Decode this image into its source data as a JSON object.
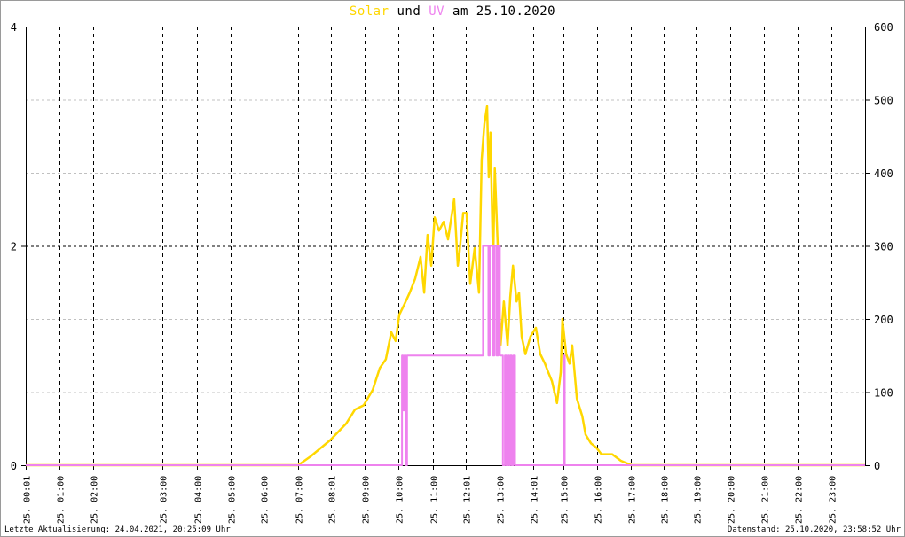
{
  "chart_data": {
    "type": "line",
    "title": {
      "part1": "Solar",
      "part2": "und",
      "part3": "UV",
      "part4": "am 25.10.2020"
    },
    "colors": {
      "solar": "#ffd700",
      "uv": "#ee82ee",
      "axis": "#000000",
      "grid_major": "#000000",
      "grid_minor": "#c0c0c0"
    },
    "x_axis": {
      "unit": "hour-equivalent sample position",
      "range": [
        0,
        24.96
      ],
      "ticks": [
        {
          "x": 0,
          "label": "25. 00:01"
        },
        {
          "x": 1.0,
          "label": "25. 01:00"
        },
        {
          "x": 2.0,
          "label": "25. 02:00"
        },
        {
          "x": 4.06,
          "label": "25. 03:00"
        },
        {
          "x": 5.09,
          "label": "25. 04:00"
        },
        {
          "x": 6.09,
          "label": "25. 05:00"
        },
        {
          "x": 7.07,
          "label": "25. 06:00"
        },
        {
          "x": 8.1,
          "label": "25. 07:00"
        },
        {
          "x": 9.08,
          "label": "25. 08:01"
        },
        {
          "x": 10.08,
          "label": "25. 09:00"
        },
        {
          "x": 11.08,
          "label": "25. 10:00"
        },
        {
          "x": 12.1,
          "label": "25. 11:00"
        },
        {
          "x": 13.1,
          "label": "25. 12:01"
        },
        {
          "x": 14.1,
          "label": "25. 13:00"
        },
        {
          "x": 15.1,
          "label": "25. 14:01"
        },
        {
          "x": 16.0,
          "label": "25. 15:00"
        },
        {
          "x": 17.0,
          "label": "25. 16:00"
        },
        {
          "x": 17.99,
          "label": "25. 17:00"
        },
        {
          "x": 18.96,
          "label": "25. 18:00"
        },
        {
          "x": 19.96,
          "label": "25. 19:00"
        },
        {
          "x": 20.94,
          "label": "25. 20:00"
        },
        {
          "x": 21.95,
          "label": "25. 21:00"
        },
        {
          "x": 22.95,
          "label": "25. 22:00"
        },
        {
          "x": 23.95,
          "label": "25. 23:00"
        }
      ]
    },
    "y_left": {
      "label": "UV",
      "range": [
        0,
        4
      ],
      "ticks": [
        "0",
        "2",
        "4"
      ],
      "tick_values": [
        0,
        2,
        4
      ]
    },
    "y_right": {
      "label": "Solar",
      "range": [
        0,
        600
      ],
      "ticks": [
        "0",
        "100",
        "200",
        "300",
        "400",
        "500",
        "600"
      ],
      "tick_values": [
        0,
        100,
        200,
        300,
        400,
        500,
        600
      ]
    },
    "series": [
      {
        "name": "Solar",
        "axis": "right",
        "points": [
          [
            0,
            0
          ],
          [
            8.1,
            0
          ],
          [
            8.47,
            12
          ],
          [
            9.05,
            34
          ],
          [
            9.53,
            57
          ],
          [
            9.79,
            76
          ],
          [
            10.05,
            82
          ],
          [
            10.32,
            103
          ],
          [
            10.53,
            133
          ],
          [
            10.71,
            145
          ],
          [
            10.87,
            182
          ],
          [
            11.0,
            170
          ],
          [
            11.11,
            206
          ],
          [
            11.24,
            218
          ],
          [
            11.42,
            236
          ],
          [
            11.58,
            255
          ],
          [
            11.74,
            285
          ],
          [
            11.85,
            236
          ],
          [
            11.95,
            315
          ],
          [
            12.06,
            273
          ],
          [
            12.16,
            339
          ],
          [
            12.29,
            321
          ],
          [
            12.43,
            333
          ],
          [
            12.56,
            309
          ],
          [
            12.74,
            364
          ],
          [
            12.85,
            273
          ],
          [
            12.9,
            291
          ],
          [
            13.01,
            345
          ],
          [
            13.11,
            345
          ],
          [
            13.22,
            248
          ],
          [
            13.35,
            297
          ],
          [
            13.48,
            236
          ],
          [
            13.56,
            418
          ],
          [
            13.64,
            467
          ],
          [
            13.72,
            491
          ],
          [
            13.77,
            394
          ],
          [
            13.82,
            455
          ],
          [
            13.9,
            273
          ],
          [
            13.95,
            406
          ],
          [
            14.04,
            297
          ],
          [
            14.12,
            164
          ],
          [
            14.22,
            224
          ],
          [
            14.33,
            164
          ],
          [
            14.41,
            230
          ],
          [
            14.49,
            273
          ],
          [
            14.6,
            224
          ],
          [
            14.67,
            236
          ],
          [
            14.75,
            176
          ],
          [
            14.86,
            152
          ],
          [
            15.01,
            176
          ],
          [
            15.17,
            188
          ],
          [
            15.3,
            152
          ],
          [
            15.44,
            139
          ],
          [
            15.54,
            127
          ],
          [
            15.65,
            115
          ],
          [
            15.8,
            85
          ],
          [
            15.91,
            127
          ],
          [
            15.96,
            200
          ],
          [
            16.07,
            152
          ],
          [
            16.17,
            139
          ],
          [
            16.25,
            164
          ],
          [
            16.39,
            91
          ],
          [
            16.55,
            67
          ],
          [
            16.65,
            42
          ],
          [
            16.81,
            30
          ],
          [
            16.97,
            24
          ],
          [
            17.12,
            15
          ],
          [
            17.44,
            15
          ],
          [
            17.7,
            6
          ],
          [
            18.02,
            0
          ],
          [
            24.96,
            0
          ]
        ]
      },
      {
        "name": "UV",
        "axis": "left",
        "step": true,
        "points": [
          [
            0,
            0
          ],
          [
            11.19,
            1
          ],
          [
            11.22,
            0.5
          ],
          [
            11.26,
            1
          ],
          [
            11.3,
            0
          ],
          [
            11.34,
            1
          ],
          [
            13.56,
            1
          ],
          [
            13.6,
            2
          ],
          [
            13.74,
            2
          ],
          [
            13.76,
            1
          ],
          [
            13.8,
            2
          ],
          [
            13.9,
            1
          ],
          [
            13.94,
            2
          ],
          [
            14.0,
            1
          ],
          [
            14.05,
            2
          ],
          [
            14.1,
            1
          ],
          [
            14.15,
            1
          ],
          [
            14.19,
            0
          ],
          [
            14.25,
            1
          ],
          [
            14.29,
            0
          ],
          [
            14.33,
            1
          ],
          [
            14.37,
            0
          ],
          [
            14.41,
            1
          ],
          [
            14.45,
            0
          ],
          [
            14.5,
            1
          ],
          [
            14.55,
            0
          ],
          [
            15.98,
            0
          ],
          [
            15.99,
            1
          ],
          [
            16.03,
            0
          ],
          [
            24.96,
            0
          ]
        ]
      }
    ]
  },
  "footer": {
    "left": "Letzte Aktualisierung: 24.04.2021, 20:25:09 Uhr",
    "right": "Datenstand: 25.10.2020, 23:58:52 Uhr"
  }
}
